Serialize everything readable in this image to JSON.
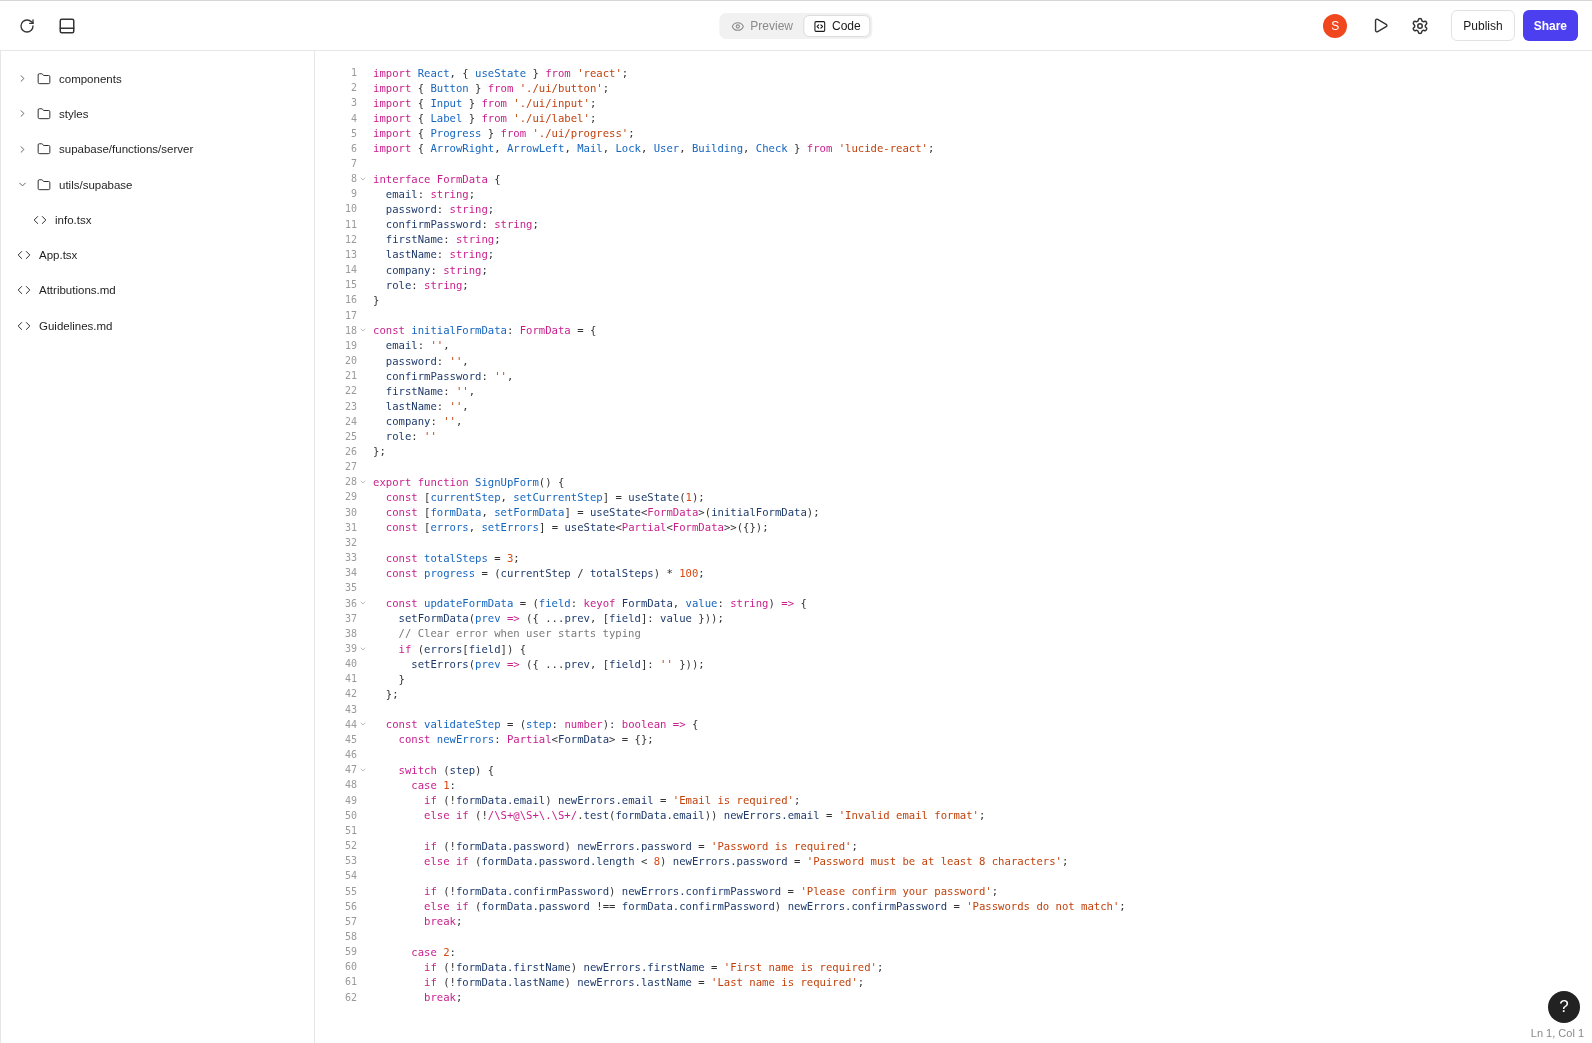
{
  "toolbar": {
    "view_tabs": [
      {
        "label": "Preview",
        "selected": false,
        "kind": "preview"
      },
      {
        "label": "Code",
        "selected": true,
        "kind": "code"
      }
    ],
    "avatar": "S",
    "publish": "Publish",
    "share": "Share"
  },
  "file_tree": [
    {
      "name": "components",
      "kind": "folder",
      "expanded": false
    },
    {
      "name": "styles",
      "kind": "folder",
      "expanded": false
    },
    {
      "name": "supabase/functions/server",
      "kind": "folder",
      "expanded": false
    },
    {
      "name": "utils/supabase",
      "kind": "folder",
      "expanded": true,
      "children": [
        {
          "name": "info.tsx",
          "kind": "file"
        }
      ]
    },
    {
      "name": "App.tsx",
      "kind": "file"
    },
    {
      "name": "Attributions.md",
      "kind": "file"
    },
    {
      "name": "Guidelines.md",
      "kind": "file"
    }
  ],
  "editor": {
    "lines": [
      {
        "number": "1",
        "foldable": false,
        "tokens": [
          {
            "kind": "keyword",
            "text": "import "
          },
          {
            "kind": "name",
            "text": "React"
          },
          {
            "kind": "punct",
            "text": ", { "
          },
          {
            "kind": "name",
            "text": "useState"
          },
          {
            "kind": "punct",
            "text": " } "
          },
          {
            "kind": "keyword",
            "text": "from "
          },
          {
            "kind": "string",
            "text": "'react'"
          },
          {
            "kind": "punct",
            "text": ";"
          }
        ]
      },
      {
        "number": "2",
        "foldable": false,
        "tokens": [
          {
            "kind": "keyword",
            "text": "import "
          },
          {
            "kind": "punct",
            "text": "{ "
          },
          {
            "kind": "name",
            "text": "Button"
          },
          {
            "kind": "punct",
            "text": " } "
          },
          {
            "kind": "keyword",
            "text": "from "
          },
          {
            "kind": "string",
            "text": "'./ui/button'"
          },
          {
            "kind": "punct",
            "text": ";"
          }
        ]
      },
      {
        "number": "3",
        "foldable": false,
        "tokens": [
          {
            "kind": "keyword",
            "text": "import "
          },
          {
            "kind": "punct",
            "text": "{ "
          },
          {
            "kind": "name",
            "text": "Input"
          },
          {
            "kind": "punct",
            "text": " } "
          },
          {
            "kind": "keyword",
            "text": "from "
          },
          {
            "kind": "string",
            "text": "'./ui/input'"
          },
          {
            "kind": "punct",
            "text": ";"
          }
        ]
      },
      {
        "number": "4",
        "foldable": false,
        "tokens": [
          {
            "kind": "keyword",
            "text": "import "
          },
          {
            "kind": "punct",
            "text": "{ "
          },
          {
            "kind": "name",
            "text": "Label"
          },
          {
            "kind": "punct",
            "text": " } "
          },
          {
            "kind": "keyword",
            "text": "from "
          },
          {
            "kind": "string",
            "text": "'./ui/label'"
          },
          {
            "kind": "punct",
            "text": ";"
          }
        ]
      },
      {
        "number": "5",
        "foldable": false,
        "tokens": [
          {
            "kind": "keyword",
            "text": "import "
          },
          {
            "kind": "punct",
            "text": "{ "
          },
          {
            "kind": "name",
            "text": "Progress"
          },
          {
            "kind": "punct",
            "text": " } "
          },
          {
            "kind": "keyword",
            "text": "from "
          },
          {
            "kind": "string",
            "text": "'./ui/progress'"
          },
          {
            "kind": "punct",
            "text": ";"
          }
        ]
      },
      {
        "number": "6",
        "foldable": false,
        "tokens": [
          {
            "kind": "keyword",
            "text": "import "
          },
          {
            "kind": "punct",
            "text": "{ "
          },
          {
            "kind": "name",
            "text": "ArrowRight"
          },
          {
            "kind": "punct",
            "text": ", "
          },
          {
            "kind": "name",
            "text": "ArrowLeft"
          },
          {
            "kind": "punct",
            "text": ", "
          },
          {
            "kind": "name",
            "text": "Mail"
          },
          {
            "kind": "punct",
            "text": ", "
          },
          {
            "kind": "name",
            "text": "Lock"
          },
          {
            "kind": "punct",
            "text": ", "
          },
          {
            "kind": "name",
            "text": "User"
          },
          {
            "kind": "punct",
            "text": ", "
          },
          {
            "kind": "name",
            "text": "Building"
          },
          {
            "kind": "punct",
            "text": ", "
          },
          {
            "kind": "name",
            "text": "Check"
          },
          {
            "kind": "punct",
            "text": " } "
          },
          {
            "kind": "keyword",
            "text": "from "
          },
          {
            "kind": "string",
            "text": "'lucide-react'"
          },
          {
            "kind": "punct",
            "text": ";"
          }
        ]
      },
      {
        "number": "7",
        "foldable": false
      },
      {
        "number": "8",
        "foldable": true,
        "tokens": [
          {
            "kind": "keyword",
            "text": "interface FormData "
          },
          {
            "kind": "punct",
            "text": "{"
          }
        ]
      },
      {
        "number": "9",
        "foldable": false,
        "tokens": [
          {
            "kind": "property",
            "text": "  email"
          },
          {
            "kind": "punct",
            "text": ": "
          },
          {
            "kind": "keyword",
            "text": "string"
          },
          {
            "kind": "punct",
            "text": ";"
          }
        ]
      },
      {
        "number": "10",
        "foldable": false,
        "tokens": [
          {
            "kind": "property",
            "text": "  password"
          },
          {
            "kind": "punct",
            "text": ": "
          },
          {
            "kind": "keyword",
            "text": "string"
          },
          {
            "kind": "punct",
            "text": ";"
          }
        ]
      },
      {
        "number": "11",
        "foldable": false,
        "tokens": [
          {
            "kind": "property",
            "text": "  confirmPassword"
          },
          {
            "kind": "punct",
            "text": ": "
          },
          {
            "kind": "keyword",
            "text": "string"
          },
          {
            "kind": "punct",
            "text": ";"
          }
        ]
      },
      {
        "number": "12",
        "foldable": false,
        "tokens": [
          {
            "kind": "property",
            "text": "  firstName"
          },
          {
            "kind": "punct",
            "text": ": "
          },
          {
            "kind": "keyword",
            "text": "string"
          },
          {
            "kind": "punct",
            "text": ";"
          }
        ]
      },
      {
        "number": "13",
        "foldable": false,
        "tokens": [
          {
            "kind": "property",
            "text": "  lastName"
          },
          {
            "kind": "punct",
            "text": ": "
          },
          {
            "kind": "keyword",
            "text": "string"
          },
          {
            "kind": "punct",
            "text": ";"
          }
        ]
      },
      {
        "number": "14",
        "foldable": false,
        "tokens": [
          {
            "kind": "property",
            "text": "  company"
          },
          {
            "kind": "punct",
            "text": ": "
          },
          {
            "kind": "keyword",
            "text": "string"
          },
          {
            "kind": "punct",
            "text": ";"
          }
        ]
      },
      {
        "number": "15",
        "foldable": false,
        "tokens": [
          {
            "kind": "property",
            "text": "  role"
          },
          {
            "kind": "punct",
            "text": ": "
          },
          {
            "kind": "keyword",
            "text": "string"
          },
          {
            "kind": "punct",
            "text": ";"
          }
        ]
      },
      {
        "number": "16",
        "foldable": false,
        "tokens": [
          {
            "kind": "punct",
            "text": "}"
          }
        ]
      },
      {
        "number": "17",
        "foldable": false
      },
      {
        "number": "18",
        "foldable": true,
        "tokens": [
          {
            "kind": "keyword",
            "text": "const "
          },
          {
            "kind": "name",
            "text": "initialFormData"
          },
          {
            "kind": "punct",
            "text": ": "
          },
          {
            "kind": "keyword",
            "text": "FormData"
          },
          {
            "kind": "punct",
            "text": " = {"
          }
        ]
      },
      {
        "number": "19",
        "foldable": false,
        "tokens": [
          {
            "kind": "property",
            "text": "  email"
          },
          {
            "kind": "punct",
            "text": ": "
          },
          {
            "kind": "string",
            "text": "''"
          },
          {
            "kind": "punct",
            "text": ","
          }
        ]
      },
      {
        "number": "20",
        "foldable": false,
        "tokens": [
          {
            "kind": "property",
            "text": "  password"
          },
          {
            "kind": "punct",
            "text": ": "
          },
          {
            "kind": "string",
            "text": "''"
          },
          {
            "kind": "punct",
            "text": ","
          }
        ]
      },
      {
        "number": "21",
        "foldable": false,
        "tokens": [
          {
            "kind": "property",
            "text": "  confirmPassword"
          },
          {
            "kind": "punct",
            "text": ": "
          },
          {
            "kind": "string",
            "text": "''"
          },
          {
            "kind": "punct",
            "text": ","
          }
        ]
      },
      {
        "number": "22",
        "foldable": false,
        "tokens": [
          {
            "kind": "property",
            "text": "  firstName"
          },
          {
            "kind": "punct",
            "text": ": "
          },
          {
            "kind": "string",
            "text": "''"
          },
          {
            "kind": "punct",
            "text": ","
          }
        ]
      },
      {
        "number": "23",
        "foldable": false,
        "tokens": [
          {
            "kind": "property",
            "text": "  lastName"
          },
          {
            "kind": "punct",
            "text": ": "
          },
          {
            "kind": "string",
            "text": "''"
          },
          {
            "kind": "punct",
            "text": ","
          }
        ]
      },
      {
        "number": "24",
        "foldable": false,
        "tokens": [
          {
            "kind": "property",
            "text": "  company"
          },
          {
            "kind": "punct",
            "text": ": "
          },
          {
            "kind": "string",
            "text": "''"
          },
          {
            "kind": "punct",
            "text": ","
          }
        ]
      },
      {
        "number": "25",
        "foldable": false,
        "tokens": [
          {
            "kind": "property",
            "text": "  role"
          },
          {
            "kind": "punct",
            "text": ": "
          },
          {
            "kind": "string",
            "text": "''"
          }
        ]
      },
      {
        "number": "26",
        "foldable": false,
        "tokens": [
          {
            "kind": "punct",
            "text": "};"
          }
        ]
      },
      {
        "number": "27",
        "foldable": false
      },
      {
        "number": "28",
        "foldable": true,
        "tokens": [
          {
            "kind": "keyword",
            "text": "export function "
          },
          {
            "kind": "name",
            "text": "SignUpForm"
          },
          {
            "kind": "punct",
            "text": "() {"
          }
        ]
      },
      {
        "number": "29",
        "foldable": false,
        "tokens": [
          {
            "kind": "keyword",
            "text": "  const "
          },
          {
            "kind": "punct",
            "text": "["
          },
          {
            "kind": "name",
            "text": "currentStep"
          },
          {
            "kind": "punct",
            "text": ", "
          },
          {
            "kind": "name",
            "text": "setCurrentStep"
          },
          {
            "kind": "punct",
            "text": "] = "
          },
          {
            "kind": "property",
            "text": "useState"
          },
          {
            "kind": "punct",
            "text": "("
          },
          {
            "kind": "number",
            "text": "1"
          },
          {
            "kind": "punct",
            "text": ");"
          }
        ]
      },
      {
        "number": "30",
        "foldable": false,
        "tokens": [
          {
            "kind": "keyword",
            "text": "  const "
          },
          {
            "kind": "punct",
            "text": "["
          },
          {
            "kind": "name",
            "text": "formData"
          },
          {
            "kind": "punct",
            "text": ", "
          },
          {
            "kind": "name",
            "text": "setFormData"
          },
          {
            "kind": "punct",
            "text": "] = "
          },
          {
            "kind": "property",
            "text": "useState"
          },
          {
            "kind": "punct",
            "text": "<"
          },
          {
            "kind": "keyword",
            "text": "FormData"
          },
          {
            "kind": "punct",
            "text": ">("
          },
          {
            "kind": "property",
            "text": "initialFormData"
          },
          {
            "kind": "punct",
            "text": ");"
          }
        ]
      },
      {
        "number": "31",
        "foldable": false,
        "tokens": [
          {
            "kind": "keyword",
            "text": "  const "
          },
          {
            "kind": "punct",
            "text": "["
          },
          {
            "kind": "name",
            "text": "errors"
          },
          {
            "kind": "punct",
            "text": ", "
          },
          {
            "kind": "name",
            "text": "setErrors"
          },
          {
            "kind": "punct",
            "text": "] = "
          },
          {
            "kind": "property",
            "text": "useState"
          },
          {
            "kind": "punct",
            "text": "<"
          },
          {
            "kind": "keyword",
            "text": "Partial"
          },
          {
            "kind": "punct",
            "text": "<"
          },
          {
            "kind": "keyword",
            "text": "FormData"
          },
          {
            "kind": "punct",
            "text": ">>({});"
          }
        ]
      },
      {
        "number": "32",
        "foldable": false
      },
      {
        "number": "33",
        "foldable": false,
        "tokens": [
          {
            "kind": "keyword",
            "text": "  const "
          },
          {
            "kind": "name",
            "text": "totalSteps"
          },
          {
            "kind": "punct",
            "text": " = "
          },
          {
            "kind": "number",
            "text": "3"
          },
          {
            "kind": "punct",
            "text": ";"
          }
        ]
      },
      {
        "number": "34",
        "foldable": false,
        "tokens": [
          {
            "kind": "keyword",
            "text": "  const "
          },
          {
            "kind": "name",
            "text": "progress"
          },
          {
            "kind": "punct",
            "text": " = ("
          },
          {
            "kind": "property",
            "text": "currentStep"
          },
          {
            "kind": "punct",
            "text": " / "
          },
          {
            "kind": "property",
            "text": "totalSteps"
          },
          {
            "kind": "punct",
            "text": ") * "
          },
          {
            "kind": "number",
            "text": "100"
          },
          {
            "kind": "punct",
            "text": ";"
          }
        ]
      },
      {
        "number": "35",
        "foldable": false
      },
      {
        "number": "36",
        "foldable": true,
        "tokens": [
          {
            "kind": "keyword",
            "text": "  const "
          },
          {
            "kind": "name",
            "text": "updateFormData"
          },
          {
            "kind": "punct",
            "text": " = ("
          },
          {
            "kind": "name",
            "text": "field"
          },
          {
            "kind": "punct",
            "text": ": "
          },
          {
            "kind": "keyword",
            "text": "keyof "
          },
          {
            "kind": "property",
            "text": "FormData"
          },
          {
            "kind": "punct",
            "text": ", "
          },
          {
            "kind": "name",
            "text": "value"
          },
          {
            "kind": "punct",
            "text": ": "
          },
          {
            "kind": "keyword",
            "text": "string"
          },
          {
            "kind": "punct",
            "text": ") "
          },
          {
            "kind": "keyword",
            "text": "=>"
          },
          {
            "kind": "punct",
            "text": " {"
          }
        ]
      },
      {
        "number": "37",
        "foldable": false,
        "tokens": [
          {
            "kind": "property",
            "text": "    setFormData"
          },
          {
            "kind": "punct",
            "text": "("
          },
          {
            "kind": "name",
            "text": "prev"
          },
          {
            "kind": "keyword",
            "text": " =>"
          },
          {
            "kind": "punct",
            "text": " ({ ..."
          },
          {
            "kind": "property",
            "text": "prev"
          },
          {
            "kind": "punct",
            "text": ", ["
          },
          {
            "kind": "property",
            "text": "field"
          },
          {
            "kind": "punct",
            "text": "]: "
          },
          {
            "kind": "property",
            "text": "value"
          },
          {
            "kind": "punct",
            "text": " }));"
          }
        ]
      },
      {
        "number": "38",
        "foldable": false,
        "tokens": [
          {
            "kind": "comment",
            "text": "    // Clear error when user starts typing"
          }
        ]
      },
      {
        "number": "39",
        "foldable": true,
        "tokens": [
          {
            "kind": "keyword",
            "text": "    if "
          },
          {
            "kind": "punct",
            "text": "("
          },
          {
            "kind": "property",
            "text": "errors"
          },
          {
            "kind": "punct",
            "text": "["
          },
          {
            "kind": "property",
            "text": "field"
          },
          {
            "kind": "punct",
            "text": "]) {"
          }
        ]
      },
      {
        "number": "40",
        "foldable": false,
        "tokens": [
          {
            "kind": "property",
            "text": "      setErrors"
          },
          {
            "kind": "punct",
            "text": "("
          },
          {
            "kind": "name",
            "text": "prev"
          },
          {
            "kind": "keyword",
            "text": " =>"
          },
          {
            "kind": "punct",
            "text": " ({ ..."
          },
          {
            "kind": "property",
            "text": "prev"
          },
          {
            "kind": "punct",
            "text": ", ["
          },
          {
            "kind": "property",
            "text": "field"
          },
          {
            "kind": "punct",
            "text": "]: "
          },
          {
            "kind": "string",
            "text": "''"
          },
          {
            "kind": "punct",
            "text": " }));"
          }
        ]
      },
      {
        "number": "41",
        "foldable": false,
        "tokens": [
          {
            "kind": "punct",
            "text": "    }"
          }
        ]
      },
      {
        "number": "42",
        "foldable": false,
        "tokens": [
          {
            "kind": "punct",
            "text": "  };"
          }
        ]
      },
      {
        "number": "43",
        "foldable": false
      },
      {
        "number": "44",
        "foldable": true,
        "tokens": [
          {
            "kind": "keyword",
            "text": "  const "
          },
          {
            "kind": "name",
            "text": "validateStep"
          },
          {
            "kind": "punct",
            "text": " = ("
          },
          {
            "kind": "name",
            "text": "step"
          },
          {
            "kind": "punct",
            "text": ": "
          },
          {
            "kind": "keyword",
            "text": "number"
          },
          {
            "kind": "punct",
            "text": "): "
          },
          {
            "kind": "keyword",
            "text": "boolean =>"
          },
          {
            "kind": "punct",
            "text": " {"
          }
        ]
      },
      {
        "number": "45",
        "foldable": false,
        "tokens": [
          {
            "kind": "keyword",
            "text": "    const "
          },
          {
            "kind": "name",
            "text": "newErrors"
          },
          {
            "kind": "punct",
            "text": ": "
          },
          {
            "kind": "keyword",
            "text": "Partial"
          },
          {
            "kind": "punct",
            "text": "<"
          },
          {
            "kind": "property",
            "text": "FormData"
          },
          {
            "kind": "punct",
            "text": "> = {};"
          }
        ]
      },
      {
        "number": "46",
        "foldable": false
      },
      {
        "number": "47",
        "foldable": true,
        "tokens": [
          {
            "kind": "keyword",
            "text": "    switch "
          },
          {
            "kind": "punct",
            "text": "("
          },
          {
            "kind": "property",
            "text": "step"
          },
          {
            "kind": "punct",
            "text": ") {"
          }
        ]
      },
      {
        "number": "48",
        "foldable": false,
        "tokens": [
          {
            "kind": "keyword",
            "text": "      case "
          },
          {
            "kind": "number",
            "text": "1"
          },
          {
            "kind": "punct",
            "text": ":"
          }
        ]
      },
      {
        "number": "49",
        "foldable": false,
        "tokens": [
          {
            "kind": "keyword",
            "text": "        if "
          },
          {
            "kind": "punct",
            "text": "(!"
          },
          {
            "kind": "property",
            "text": "formData.email"
          },
          {
            "kind": "punct",
            "text": ") "
          },
          {
            "kind": "property",
            "text": "newErrors.email"
          },
          {
            "kind": "punct",
            "text": " = "
          },
          {
            "kind": "string",
            "text": "'Email is required'"
          },
          {
            "kind": "punct",
            "text": ";"
          }
        ]
      },
      {
        "number": "50",
        "foldable": false,
        "tokens": [
          {
            "kind": "keyword",
            "text": "        else if "
          },
          {
            "kind": "punct",
            "text": "(!"
          },
          {
            "kind": "keyword",
            "text": "/\\S+@\\S+\\.\\S+/"
          },
          {
            "kind": "punct",
            "text": "."
          },
          {
            "kind": "property",
            "text": "test"
          },
          {
            "kind": "punct",
            "text": "("
          },
          {
            "kind": "property",
            "text": "formData.email"
          },
          {
            "kind": "punct",
            "text": ")) "
          },
          {
            "kind": "property",
            "text": "newErrors.email"
          },
          {
            "kind": "punct",
            "text": " = "
          },
          {
            "kind": "string",
            "text": "'Invalid email format'"
          },
          {
            "kind": "punct",
            "text": ";"
          }
        ]
      },
      {
        "number": "51",
        "foldable": false
      },
      {
        "number": "52",
        "foldable": false,
        "tokens": [
          {
            "kind": "keyword",
            "text": "        if "
          },
          {
            "kind": "punct",
            "text": "(!"
          },
          {
            "kind": "property",
            "text": "formData.password"
          },
          {
            "kind": "punct",
            "text": ") "
          },
          {
            "kind": "property",
            "text": "newErrors.password"
          },
          {
            "kind": "punct",
            "text": " = "
          },
          {
            "kind": "string",
            "text": "'Password is required'"
          },
          {
            "kind": "punct",
            "text": ";"
          }
        ]
      },
      {
        "number": "53",
        "foldable": false,
        "tokens": [
          {
            "kind": "keyword",
            "text": "        else if "
          },
          {
            "kind": "punct",
            "text": "("
          },
          {
            "kind": "property",
            "text": "formData.password.length"
          },
          {
            "kind": "punct",
            "text": " < "
          },
          {
            "kind": "number",
            "text": "8"
          },
          {
            "kind": "punct",
            "text": ") "
          },
          {
            "kind": "property",
            "text": "newErrors.password"
          },
          {
            "kind": "punct",
            "text": " = "
          },
          {
            "kind": "string",
            "text": "'Password must be at least 8 characters'"
          },
          {
            "kind": "punct",
            "text": ";"
          }
        ]
      },
      {
        "number": "54",
        "foldable": false
      },
      {
        "number": "55",
        "foldable": false,
        "tokens": [
          {
            "kind": "keyword",
            "text": "        if "
          },
          {
            "kind": "punct",
            "text": "(!"
          },
          {
            "kind": "property",
            "text": "formData.confirmPassword"
          },
          {
            "kind": "punct",
            "text": ") "
          },
          {
            "kind": "property",
            "text": "newErrors.confirmPassword"
          },
          {
            "kind": "punct",
            "text": " = "
          },
          {
            "kind": "string",
            "text": "'Please confirm your password'"
          },
          {
            "kind": "punct",
            "text": ";"
          }
        ]
      },
      {
        "number": "56",
        "foldable": false,
        "tokens": [
          {
            "kind": "keyword",
            "text": "        else if "
          },
          {
            "kind": "punct",
            "text": "("
          },
          {
            "kind": "property",
            "text": "formData.password"
          },
          {
            "kind": "punct",
            "text": " !== "
          },
          {
            "kind": "property",
            "text": "formData.confirmPassword"
          },
          {
            "kind": "punct",
            "text": ") "
          },
          {
            "kind": "property",
            "text": "newErrors.confirmPassword"
          },
          {
            "kind": "punct",
            "text": " = "
          },
          {
            "kind": "string",
            "text": "'Passwords do not match'"
          },
          {
            "kind": "punct",
            "text": ";"
          }
        ]
      },
      {
        "number": "57",
        "foldable": false,
        "tokens": [
          {
            "kind": "keyword",
            "text": "        break"
          },
          {
            "kind": "punct",
            "text": ";"
          }
        ]
      },
      {
        "number": "58",
        "foldable": false
      },
      {
        "number": "59",
        "foldable": false,
        "tokens": [
          {
            "kind": "keyword",
            "text": "      case "
          },
          {
            "kind": "number",
            "text": "2"
          },
          {
            "kind": "punct",
            "text": ":"
          }
        ]
      },
      {
        "number": "60",
        "foldable": false,
        "tokens": [
          {
            "kind": "keyword",
            "text": "        if "
          },
          {
            "kind": "punct",
            "text": "(!"
          },
          {
            "kind": "property",
            "text": "formData.firstName"
          },
          {
            "kind": "punct",
            "text": ") "
          },
          {
            "kind": "property",
            "text": "newErrors.firstName"
          },
          {
            "kind": "punct",
            "text": " = "
          },
          {
            "kind": "string",
            "text": "'First name is required'"
          },
          {
            "kind": "punct",
            "text": ";"
          }
        ]
      },
      {
        "number": "61",
        "foldable": false,
        "tokens": [
          {
            "kind": "keyword",
            "text": "        if "
          },
          {
            "kind": "punct",
            "text": "(!"
          },
          {
            "kind": "property",
            "text": "formData.lastName"
          },
          {
            "kind": "punct",
            "text": ") "
          },
          {
            "kind": "property",
            "text": "newErrors.lastName"
          },
          {
            "kind": "punct",
            "text": " = "
          },
          {
            "kind": "string",
            "text": "'Last name is required'"
          },
          {
            "kind": "punct",
            "text": ";"
          }
        ]
      },
      {
        "number": "62",
        "foldable": false,
        "tokens": [
          {
            "kind": "keyword",
            "text": "        break"
          },
          {
            "kind": "punct",
            "text": ";"
          }
        ]
      }
    ],
    "status": "Ln 1, Col 1"
  },
  "help_button": "?"
}
